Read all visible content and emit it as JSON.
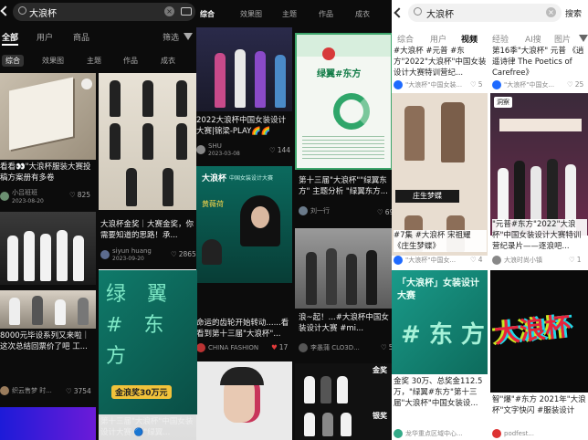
{
  "p1": {
    "search": "大浪杯",
    "tabs": [
      "全部",
      "用户",
      "商品"
    ],
    "filter": "筛选",
    "subtabs": [
      "综合",
      "效果图",
      "主题",
      "作品",
      "成衣"
    ],
    "cards": [
      {
        "cap": "看看👀\"大浪杯服装大赛投稿方案册有多卷",
        "user": "小吕班班",
        "date": "2023-08-20",
        "likes": "825"
      },
      {
        "cap": "大浪杯金奖｜大赛金奖，你需要知道的思路！承...",
        "user": "siyun huang",
        "date": "2023-09-20",
        "likes": "2865"
      },
      {
        "cap": "8000元毕设系列又来啦｜这次总结回票价了吧 工...",
        "user": "织云售梦 时...",
        "likes": "3754"
      }
    ]
  },
  "p2": {
    "subtabs": [
      "综合",
      "效果图",
      "主题",
      "作品",
      "成衣"
    ],
    "cards": [
      {
        "cap": "2022大浪杯中国女装设计大赛|锦梁-PLAY🌈🌈",
        "user": "SHU",
        "date": "2023-03-08",
        "likes": "144"
      },
      {
        "cap": "第十三届\"大浪杯\"\"绿翼东方\" 主题分析 \"绿翼东方...",
        "user": "刘一行",
        "likes": "69",
        "poster": "绿翼#东方"
      },
      {
        "cap": "命运的齿轮开始转动......看看到第十三届\"大浪杯\"...",
        "user": "CHINA FASHION",
        "likes": "17",
        "heart": "#e23b3b",
        "brand": "大浪杯",
        "brand_sub": "中国女装设计大赛",
        "name": "黄薇荷"
      },
      {
        "cap": "浪~起！...#大浪杯中国女装设计大赛 #mi...",
        "user": "李愚蒲 CLO3D...",
        "likes": "57"
      },
      {
        "cap": "第十三届\"大浪杯\"中国女装设计大赛 🔵\"绿翼...",
        "big": "绿 翼 # 东 方",
        "prize": "金浪奖30万元"
      },
      {
        "label": "金奖",
        "label2": "银奖"
      }
    ]
  },
  "p3": {
    "search": "大浪杯",
    "search_btn": "搜索",
    "tabs": [
      "综合",
      "用户",
      "视频",
      "经验",
      "AI搜",
      "图片"
    ],
    "active_tab": "视频",
    "cards": [
      {
        "cap": "#大浪杯 #元普 #东方\"2022\"大浪杯\"中国女装设计大赛特训营纪...",
        "user": "\"大浪杯\"中国女装...",
        "likes": "5"
      },
      {
        "cap": "第16季\"大浪杯\" 元普 《逍遥诗律 The Poetics of Carefree》",
        "user": "\"大浪杯\"中国女...",
        "likes": "25"
      },
      {
        "cap": "#7集 #大浪杯 宋祖耀 《庄生梦蝶》",
        "user": "\"大浪杯\"中国女...",
        "likes": "4",
        "banner": "庄生梦蝶"
      },
      {
        "cap": "\"元普#东方\"2022\"大浪杯\"中国女装设计大赛特训营纪录片——逐浪吧...",
        "user": "大浪时尚小镇",
        "likes": "1",
        "badge": "洞察"
      },
      {
        "cap": "金奖 30万、总奖金112.5 万，\"绿翼#东方\"第十三届\"大浪杯\"中国女装设...",
        "user": "龙华重点区域中心...",
        "poster": "「大浪杯」女装设计大赛",
        "big": "# 东 方"
      },
      {
        "cap": "智\"爆\"#东方 2021年\"大浪杯\"文字快闪 #服装设计",
        "big": "大浪杯",
        "user": "podfest..."
      }
    ]
  },
  "colors": {
    "accent": "#fe2c55",
    "link": "#1e6aff",
    "poster_green": "#0d6b5c",
    "poster_teal": "#1a9b8a"
  }
}
